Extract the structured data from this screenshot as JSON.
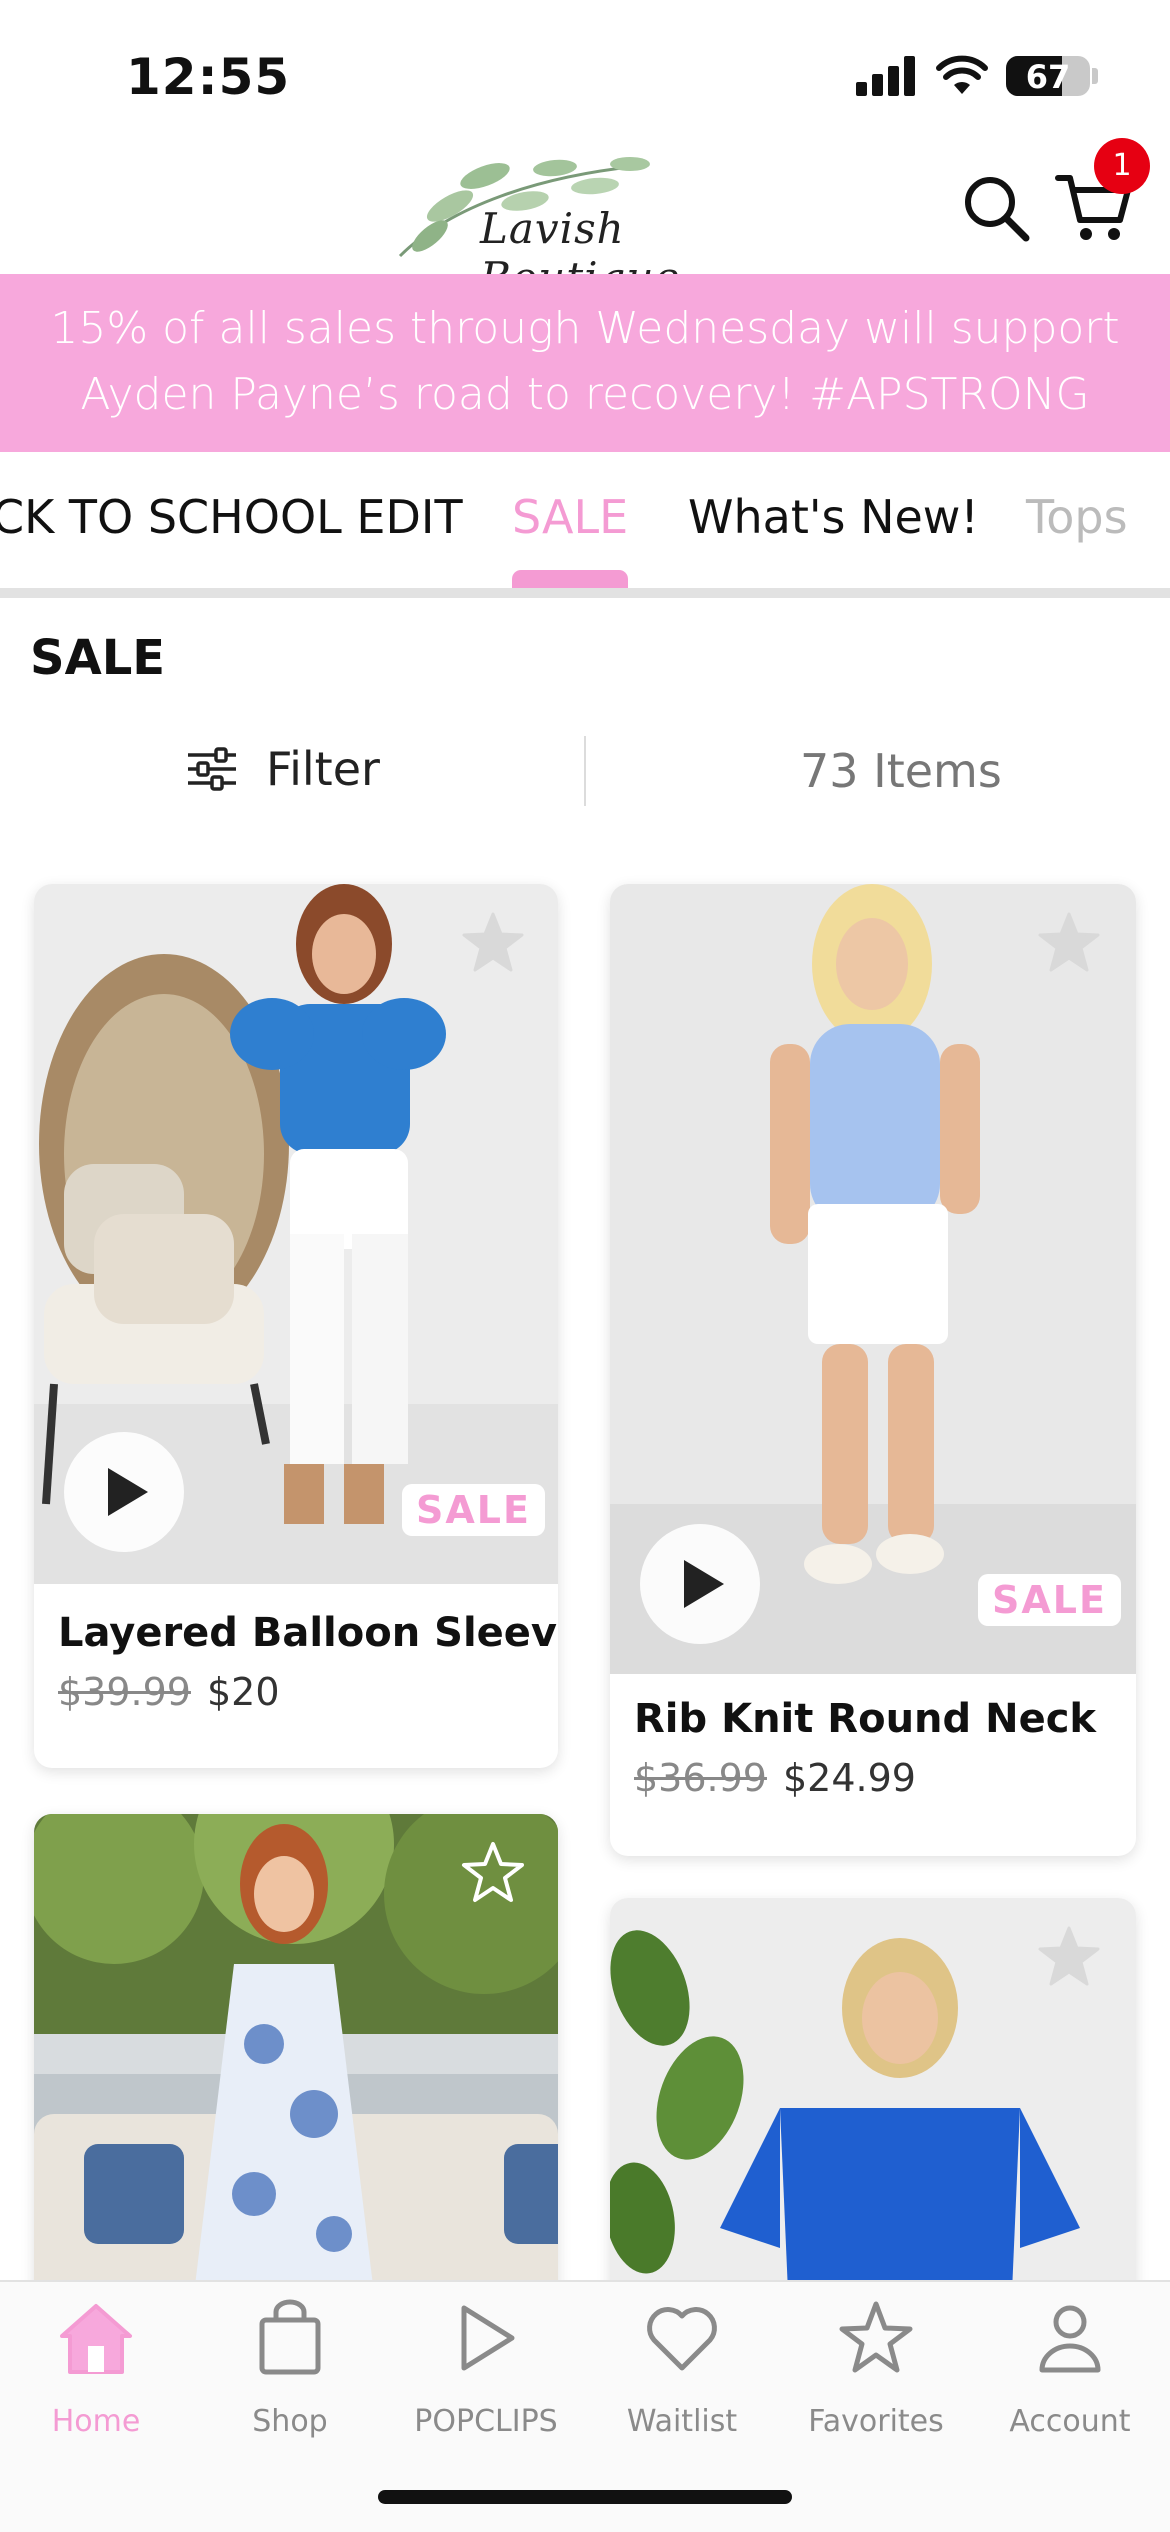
{
  "status_bar": {
    "time": "12:55",
    "battery": "67",
    "battery_level": 0.67
  },
  "header": {
    "logo_text": "Lavish Boutique",
    "cart_count": "1"
  },
  "banner": {
    "line1": "15% of all sales through Wednesday will support",
    "line2": "Ayden Payne’s road to recovery! #APSTRONG"
  },
  "tabs": [
    {
      "label": "CK TO SCHOOL EDIT",
      "active": false
    },
    {
      "label": "SALE",
      "active": true
    },
    {
      "label": "What's New!",
      "active": false
    },
    {
      "label": "Tops",
      "active": false
    }
  ],
  "section": {
    "title": "SALE",
    "filter_label": "Filter",
    "items_count": "73 Items"
  },
  "products": [
    {
      "name": "Layered Balloon Sleeve",
      "old_price": "$39.99",
      "price": "$20",
      "badge": "SALE"
    },
    {
      "name": "Rib Knit Round Neck",
      "old_price": "$36.99",
      "price": "$24.99",
      "badge": "SALE"
    },
    {
      "name": "",
      "old_price": "",
      "price": "",
      "badge": ""
    },
    {
      "name": "",
      "old_price": "",
      "price": "",
      "badge": ""
    }
  ],
  "bottom_nav": [
    {
      "label": "Home",
      "icon": "home-icon",
      "active": true
    },
    {
      "label": "Shop",
      "icon": "bag-icon",
      "active": false
    },
    {
      "label": "POPCLIPS",
      "icon": "play-icon",
      "active": false
    },
    {
      "label": "Waitlist",
      "icon": "heart-icon",
      "active": false
    },
    {
      "label": "Favorites",
      "icon": "star-icon",
      "active": false
    },
    {
      "label": "Account",
      "icon": "person-icon",
      "active": false
    }
  ],
  "colors": {
    "accent_pink": "#f49bd3",
    "banner_pink": "#f7a8dc",
    "badge_red": "#e60012"
  }
}
